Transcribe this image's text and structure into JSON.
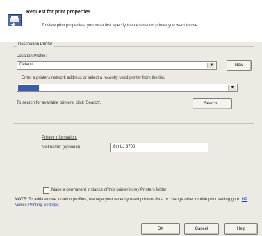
{
  "header": {
    "title": "Request for print properties",
    "description": "To view print properties, you must first specify the destination printer you want to use."
  },
  "destination": {
    "group_label": "Destination Printer",
    "location_profile_label": "Location Profile:",
    "location_profile_value": "Default",
    "new_button": "New",
    "address_instruction": "Enter a printers network address or select a recently used printer from the list.",
    "address_value": "",
    "search_hint": "To search for available printers, click 'Search'.",
    "search_button": "Search..."
  },
  "printer_info": {
    "heading": "Printer Information:",
    "nickname_label": "Nickname: (optional)",
    "nickname_value": "8th LJ 3700"
  },
  "permanent_checkbox": {
    "label": "Make a permanent instance of this printer in my Printers folder",
    "checked": false
  },
  "note": {
    "bold": "NOTE:",
    "text": "To add/remove location profiles, manage your recently used printers lists, or change other mobile print setting go to",
    "link": "HP Mobile Printing Settings",
    "end": "."
  },
  "buttons": {
    "ok": "OK",
    "cancel": "Cancel",
    "help": "Help"
  },
  "colors": {
    "dialog_bg": "#eceae2",
    "selection": "#3d5ba8",
    "link": "#1a3fb5"
  },
  "icons": {
    "header": "printer-arrows-icon",
    "dropdown": "chevron-down-icon"
  }
}
